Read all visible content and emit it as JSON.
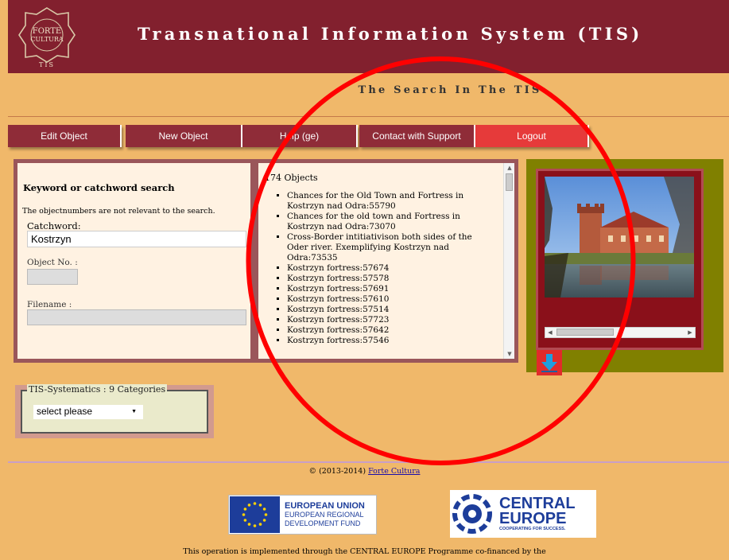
{
  "header": {
    "title": "Transnational Information System (TIS)",
    "logo_lines": [
      "FORTE",
      "CULTURA",
      "TIS"
    ]
  },
  "subtitle": "The Search In The TIS",
  "nav": {
    "items": [
      {
        "label": "Edit Object"
      },
      {
        "label": "New Object"
      },
      {
        "label": "Help (ge)"
      },
      {
        "label": "Contact with Support"
      },
      {
        "label": "Logout"
      }
    ]
  },
  "search": {
    "title": "Keyword or catchword search",
    "note": "The objectnumbers are not relevant to the search.",
    "catchword_label": "Catchword:",
    "catchword_value": "Kostrzyn",
    "objno_label": "Object No. :",
    "filename_label": "Filename :"
  },
  "results": {
    "count": "174 Objects",
    "items": [
      "Chances for the Old Town and Fortress in Kostrzyn nad Odra:55790",
      "Chances for the old town and Fortress in Kostrzyn nad Odra:73070",
      "Cross-Border intitiativison both sides of the Oder river. Exemplifying Kostrzyn nad Odra:73535",
      "Kostrzyn fortress:57674",
      "Kostrzyn fortress:57578",
      "Kostrzyn fortress:57691",
      "Kostrzyn fortress:57610",
      "Kostrzyn fortress:57514",
      "Kostrzyn fortress:57723",
      "Kostrzyn fortress:57642",
      "Kostrzyn fortress:57546"
    ]
  },
  "systematics": {
    "legend": "TIS-Systematics : 9 Categories",
    "selected": "select please"
  },
  "footer": {
    "copyright": "© (2013-2014)",
    "link": "Forte Cultura",
    "eu_lines": [
      "EUROPEAN UNION",
      "EUROPEAN REGIONAL",
      "DEVELOPMENT FUND"
    ],
    "ce_lines": [
      "CENTRAL",
      "EUROPE",
      "COOPERATING FOR SUCCESS."
    ],
    "note": "This operation is implemented through the CENTRAL EUROPE Programme co-financed by the"
  },
  "colors": {
    "header": "#82202e",
    "background": "#f0b86a",
    "nav_button": "#8f2c38",
    "logout_button": "#e63a3a",
    "annotation_circle": "#ff0000"
  },
  "icons": {
    "download": "download-arrow-icon"
  }
}
